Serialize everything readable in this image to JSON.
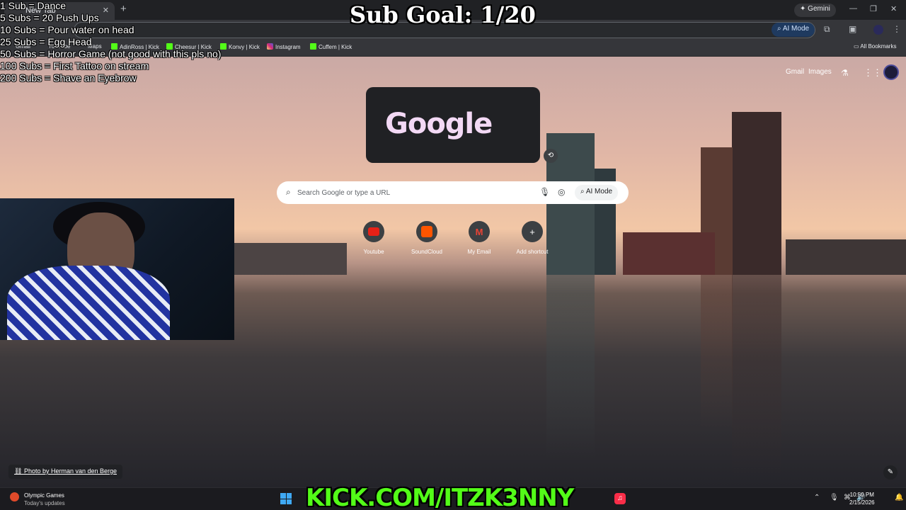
{
  "browser": {
    "tab_title": "New Tab",
    "tab_close": "✕",
    "new_tab": "+",
    "gemini_label": "Gemini",
    "address_text": "",
    "ai_mode_label": "AI Mode",
    "bookmarks": [
      {
        "label": "Gmail",
        "icon": "gmail-icon"
      },
      {
        "label": "YouTube",
        "icon": "youtube-icon"
      },
      {
        "label": "Maps",
        "icon": "maps-icon"
      },
      {
        "label": "AdinRoss | Kick",
        "icon": "kick-icon"
      },
      {
        "label": "Cheesur | Kick",
        "icon": "kick-icon"
      },
      {
        "label": "Konvy | Kick",
        "icon": "kick-icon"
      },
      {
        "label": "Instagram",
        "icon": "instagram-icon"
      },
      {
        "label": "Cuffem | Kick",
        "icon": "kick-icon"
      }
    ],
    "all_bookmarks": "All Bookmarks"
  },
  "overlay": {
    "sub_goal": "Sub Goal: 1/20",
    "goals": [
      "1 Sub = Dance",
      "5 Subs = 20 Push Ups",
      "10 Subs =  Pour water on head",
      "25 Subs = Egg Head",
      "50 Subs =  Horror Game (not good with this pls no)",
      "100 Subs = First Tattoo on stream",
      "200 Subs =  Shave an Eyebrow"
    ],
    "kick_url": "KICK.COM/ITZK3NNY"
  },
  "google": {
    "gmail": "Gmail",
    "images": "Images",
    "doodle_text": "Google",
    "search_placeholder": "Search Google or type a URL",
    "ai_mode_label": "AI Mode",
    "shortcuts": [
      {
        "label": "Youtube",
        "icon": "youtube-icon",
        "color": "#e62117"
      },
      {
        "label": "SoundCloud",
        "icon": "soundcloud-icon",
        "color": "#ff5500"
      },
      {
        "label": "My Email",
        "icon": "gmail-icon",
        "color": "#3c4043"
      },
      {
        "label": "Add shortcut",
        "icon": "plus-icon",
        "color": "#3c4043"
      }
    ],
    "photo_credit": "Photo by Herman van den Berge"
  },
  "taskbar": {
    "news_title": "Olympic Games",
    "news_sub": "Today's updates",
    "time": "10:50 PM",
    "date": "2/15/2026"
  }
}
